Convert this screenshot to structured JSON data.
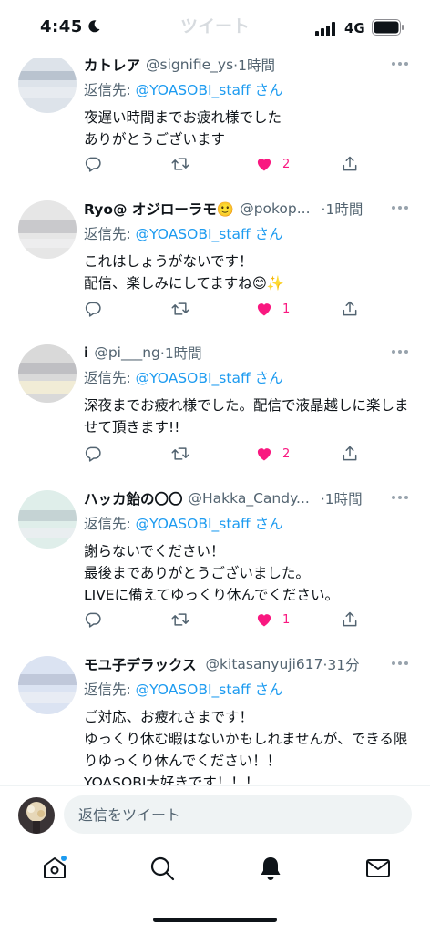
{
  "status_bar": {
    "time": "4:45",
    "network": "4G"
  },
  "header": {
    "title": "ツイート"
  },
  "tweets": [
    {
      "name": "カトレア",
      "handle": "@signifie_ys",
      "time": "·1時間",
      "reply_prefix": "返信先: ",
      "reply_to": "@YOASOBI_staff",
      "reply_suffix": "さん",
      "text": "夜遅い時間までお疲れ様でした\nありがとうございます",
      "likes": "2",
      "avatar_colors": [
        "#dde3ea",
        "#b9c3cf",
        "#e7ebf0"
      ]
    },
    {
      "name": "Ryo@ オジローラモ🙂",
      "handle": "@pokop...",
      "time": "·1時間",
      "reply_prefix": "返信先: ",
      "reply_to": "@YOASOBI_staff",
      "reply_suffix": "さん",
      "text": "これはしょうがないです！\n配信、楽しみにしてますね😊✨",
      "likes": "1",
      "avatar_colors": [
        "#e6e6e6",
        "#c9c9cc",
        "#ededee"
      ]
    },
    {
      "name": "i",
      "handle": "@pi___ng",
      "time": "·1時間",
      "reply_prefix": "返信先: ",
      "reply_to": "@YOASOBI_staff",
      "reply_suffix": "さん",
      "text": "深夜までお疲れ様でした。配信で液晶越しに楽しませて頂きます!!",
      "likes": "2",
      "avatar_colors": [
        "#d9d9d9",
        "#bfbfc3",
        "#f1ecd6"
      ]
    },
    {
      "name": "ハッカ飴の〇〇",
      "handle": "@Hakka_Candy...",
      "time": "·1時間",
      "reply_prefix": "返信先: ",
      "reply_to": "@YOASOBI_staff",
      "reply_suffix": "さん",
      "text": "謝らないでください！\n最後までありがとうございました。\nLIVEに備えてゆっくり休んでください。",
      "likes": "1",
      "avatar_colors": [
        "#dfeeea",
        "#c5d3d4",
        "#e9eef0"
      ]
    },
    {
      "name": "モユ子デラックス",
      "handle": "@kitasanyuji617",
      "time": "·31分",
      "reply_prefix": "返信先: ",
      "reply_to": "@YOASOBI_staff",
      "reply_suffix": "さん",
      "text": "ご対応、お疲れさまです！\nゆっくり休む暇はないかもしれませんが、できる限りゆっくり休んでください！！\nYOASOBI大好きです！！！",
      "likes": "",
      "avatar_colors": [
        "#dbe3f2",
        "#c0c8da",
        "#e8ecf4"
      ]
    }
  ],
  "reply_bar": {
    "placeholder": "返信をツイート"
  },
  "tab_bar": {
    "items": [
      "home-icon",
      "search-icon",
      "notifications-icon",
      "messages-icon"
    ]
  },
  "colors": {
    "accent": "#1d9bf0",
    "like": "#f91880",
    "text": "#0f1419",
    "secondary": "#536471"
  }
}
